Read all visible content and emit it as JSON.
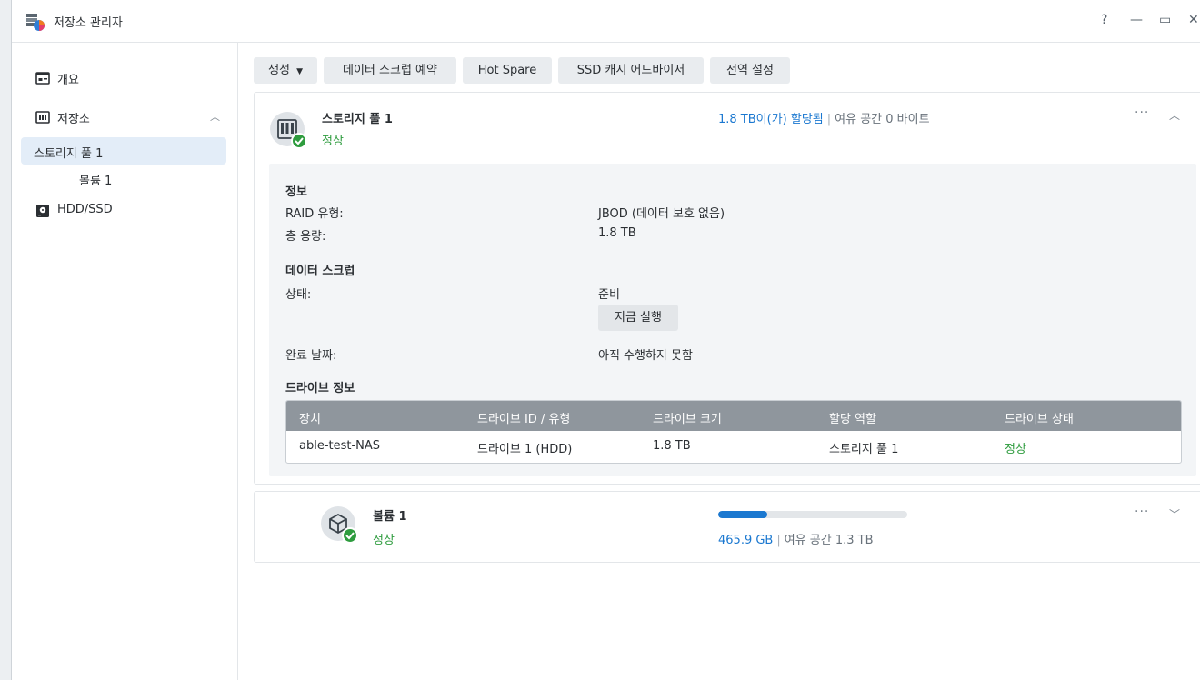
{
  "window": {
    "title": "저장소 관리자",
    "controls": {
      "help": "?",
      "minimize": "—",
      "maximize": "▭",
      "close": "✕"
    }
  },
  "sidebar": {
    "overview": "개요",
    "storage": "저장소",
    "storage_pool": "스토리지 풀 1",
    "volume": "볼륨 1",
    "hdd_ssd": "HDD/SSD"
  },
  "toolbar": {
    "create": "생성",
    "scrub_schedule": "데이터 스크럽 예약",
    "hot_spare": "Hot Spare",
    "ssd_advisor": "SSD 캐시 어드바이저",
    "global_settings": "전역 설정"
  },
  "pool": {
    "name": "스토리지 풀 1",
    "status": "정상",
    "allocated": "1.8 TB이(가) 할당됨",
    "free": "여유 공간 0 바이트",
    "info_heading": "정보",
    "raid_label": "RAID 유형:",
    "raid_value": "JBOD (데이터 보호 없음)",
    "capacity_label": "총 용량:",
    "capacity_value": "1.8 TB",
    "scrub_heading": "데이터 스크럽",
    "state_label": "상태:",
    "state_value": "준비",
    "run_now": "지금 실행",
    "completed_label": "완료 날짜:",
    "completed_value": "아직 수행하지 못함",
    "drive_heading": "드라이브 정보",
    "table": {
      "headers": [
        "장치",
        "드라이브 ID / 유형",
        "드라이브 크기",
        "할당 역할",
        "드라이브 상태"
      ],
      "rows": [
        [
          "able-test-NAS",
          "드라이브 1 (HDD)",
          "1.8 TB",
          "스토리지 풀 1",
          "정상"
        ]
      ]
    }
  },
  "volume": {
    "name": "볼륨 1",
    "status": "정상",
    "used": "465.9 GB",
    "free": "여유 공간 1.3 TB",
    "usage_fraction": 0.26
  },
  "colors": {
    "accent": "#1b78d0",
    "ok": "#2e9c3e",
    "table_header": "#8f969d"
  }
}
